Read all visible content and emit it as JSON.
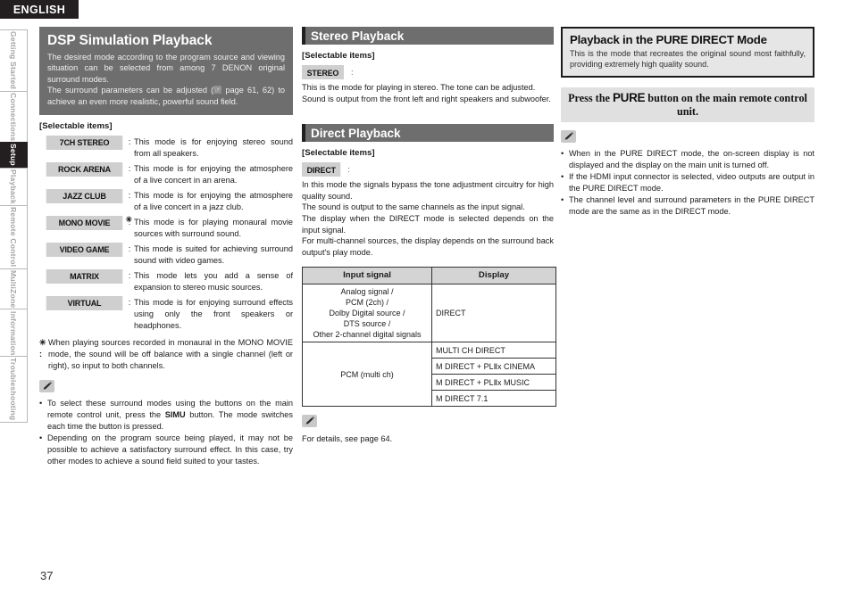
{
  "banner": {
    "language": "ENGLISH"
  },
  "sidebar": {
    "items": [
      {
        "label": "Getting Started",
        "active": false
      },
      {
        "label": "Connections",
        "active": false
      },
      {
        "label": "Setup",
        "active": true
      },
      {
        "label": "Playback",
        "active": false
      },
      {
        "label": "Remote Control",
        "active": false
      },
      {
        "label": "MultiZone",
        "active": false
      },
      {
        "label": "Information",
        "active": false
      },
      {
        "label": "Troubleshooting",
        "active": false
      }
    ]
  },
  "page": {
    "number": "37"
  },
  "column1": {
    "intro": {
      "title": "DSP Simulation Playback",
      "para1": "The desired mode according to the program source and viewing situation can be selected from among 7 DENON original surround modes.",
      "para2_before": "The surround parameters can be adjusted (",
      "para2_icon": "page-ref-hand-icon",
      "para2_after": " page 61, 62) to achieve an even more realistic, powerful sound field."
    },
    "selectable_label": "[Selectable items]",
    "modes": [
      {
        "name": "7CH STEREO",
        "star": "",
        "desc": "This mode is for enjoying stereo sound from all speakers."
      },
      {
        "name": "ROCK ARENA",
        "star": "",
        "desc": "This mode is for enjoying the atmosphere of a live concert in an arena."
      },
      {
        "name": "JAZZ CLUB",
        "star": "",
        "desc": "This mode is for enjoying the atmosphere of a live concert in a jazz club."
      },
      {
        "name": "MONO MOVIE",
        "star": "✳",
        "desc": "This mode is for playing monaural movie sources with surround sound."
      },
      {
        "name": "VIDEO GAME",
        "star": "",
        "desc": "This mode is suited for achieving surround sound with video games."
      },
      {
        "name": "MATRIX",
        "star": "",
        "desc": "This mode lets you add a sense of expansion to stereo music sources."
      },
      {
        "name": "VIRTUAL",
        "star": "",
        "desc": "This mode is for enjoying surround effects using only the front speakers or headphones."
      }
    ],
    "footnote": {
      "marker": "✳ :",
      "text": "When playing sources recorded in monaural in the MONO MOVIE mode, the sound will be off balance with a single channel (left or right), so input to both channels."
    },
    "notes": [
      {
        "before": "To select these surround modes using the buttons on the main remote control unit, press the ",
        "bold": "SIMU",
        "after": " button. The mode switches each time the button is pressed."
      },
      {
        "before": "Depending on the program source being played, it may not be possible to achieve a satisfactory surround effect. In this case, try other modes to achieve a sound field suited to your tastes.",
        "bold": "",
        "after": ""
      }
    ]
  },
  "column2": {
    "stereo": {
      "header": "Stereo Playback",
      "selectable_label": "[Selectable items]",
      "badge": "STEREO",
      "lines": [
        "This is the mode for playing in stereo. The tone can be adjusted.",
        "Sound is output from the front left and right speakers and subwoofer."
      ]
    },
    "direct": {
      "header": "Direct Playback",
      "selectable_label": "[Selectable items]",
      "badge": "DIRECT",
      "lines": [
        "In this mode the signals bypass the tone adjustment circuitry for high quality sound.",
        "The sound is output to the same channels as the input signal.",
        "The display when the DIRECT mode is selected depends on the input signal.",
        "For multi-channel sources, the display depends on the surround back output's play mode."
      ]
    },
    "table": {
      "headers": [
        "Input signal",
        "Display"
      ],
      "rows": [
        {
          "input": "Analog signal /\nPCM (2ch) /\nDolby Digital source /\nDTS source /\nOther 2-channel digital signals",
          "displays": [
            "DIRECT"
          ]
        },
        {
          "input": "PCM (multi ch)",
          "displays": [
            "MULTI CH DIRECT",
            "M DIRECT + PLⅡx CINEMA",
            "M DIRECT + PLⅡx MUSIC",
            "M DIRECT 7.1"
          ]
        }
      ]
    },
    "detail_note": "For details, see page 64."
  },
  "column3": {
    "pure_direct": {
      "title": "Playback in the PURE DIRECT Mode",
      "desc": "This is the mode that recreates the original sound most faithfully, providing extremely high quality sound."
    },
    "press_bar": {
      "before": "Press the ",
      "key": "PURE",
      "after": " button on the main remote control unit."
    },
    "notes": [
      "When in the PURE DIRECT mode, the on-screen display is not displayed and the display on the main unit is turned off.",
      "If the HDMI input connector is selected, video outputs are output in the PURE DIRECT mode.",
      "The channel level and surround parameters in the PURE DIRECT mode are the same as in the DIRECT mode."
    ]
  }
}
